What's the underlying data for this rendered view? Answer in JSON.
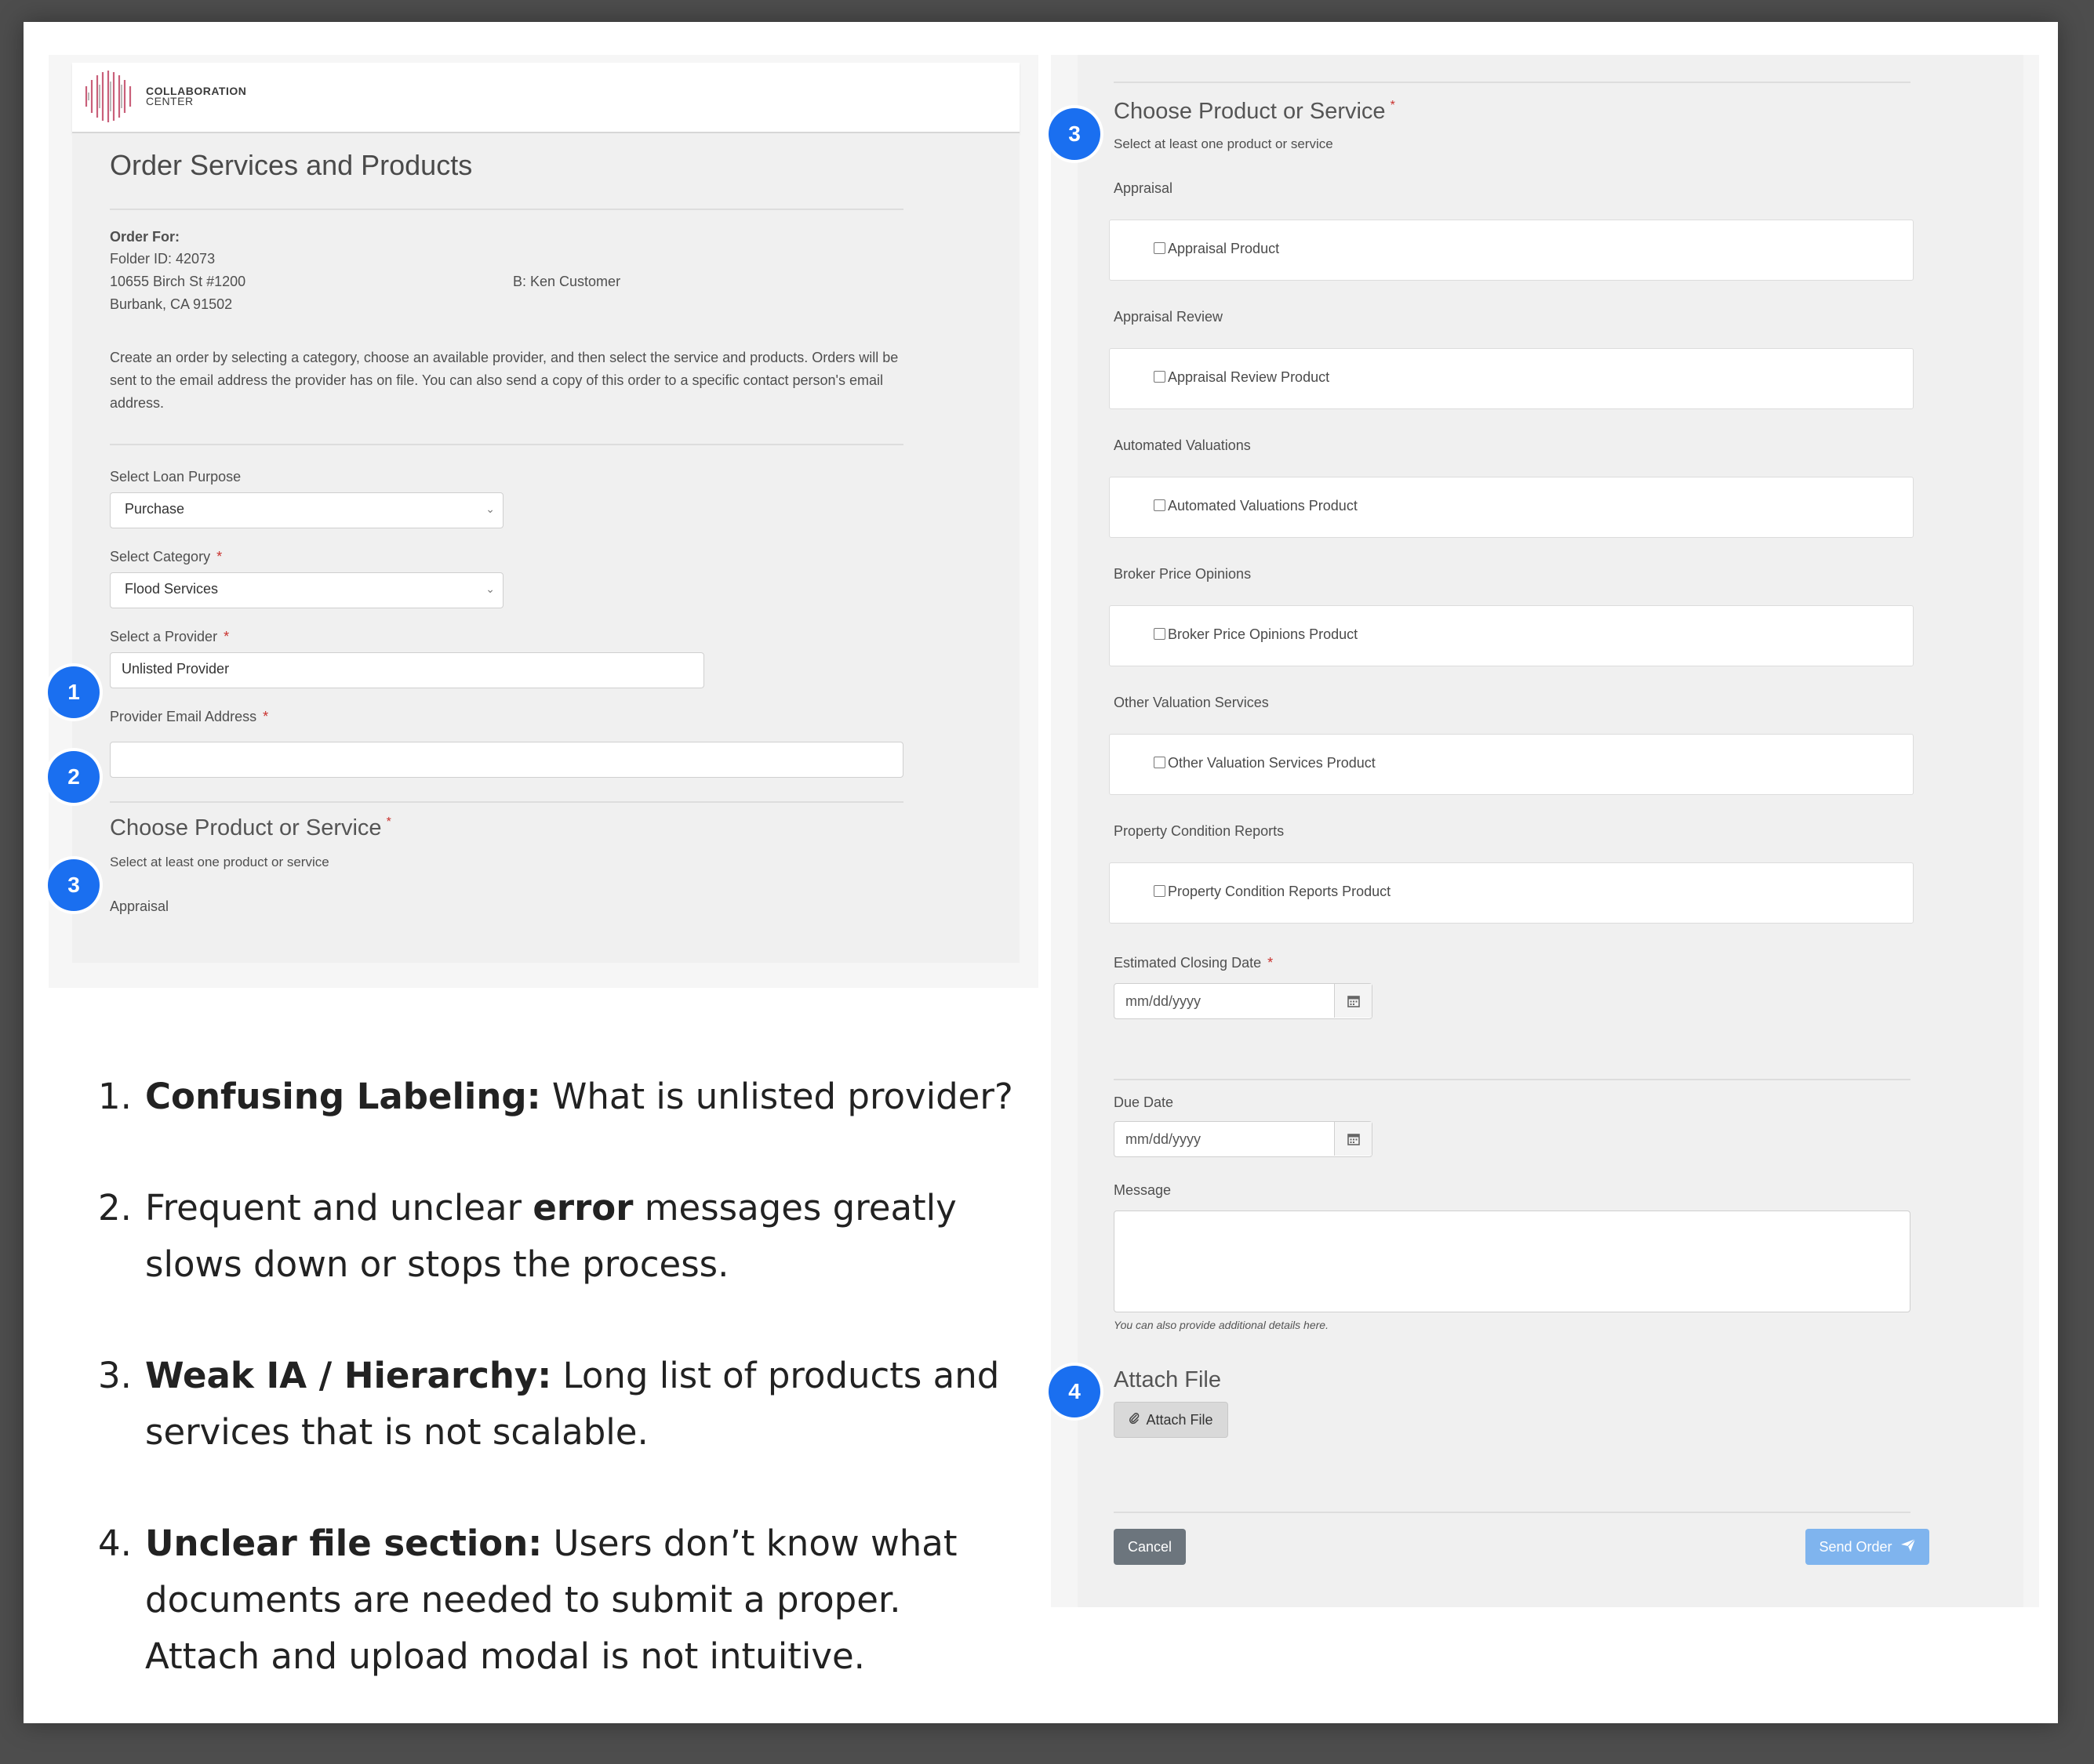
{
  "logo": {
    "line1": "COLLABORATION",
    "line2": "CENTER"
  },
  "left_form": {
    "title": "Order Services and Products",
    "order_for_label": "Order For:",
    "folder_id": "Folder ID: 42073",
    "address_line1": "10655 Birch St #1200",
    "address_line2": "Burbank, CA 91502",
    "borrower": "B: Ken Customer",
    "instructions": "Create an order by selecting a category, choose an available provider, and then select the service and products. Orders will be sent to the email address the provider has on file. You can also send a copy of this order to a specific contact person's email address.",
    "loan_purpose_label": "Select Loan Purpose",
    "loan_purpose_value": "Purchase",
    "category_label": "Select Category",
    "category_value": "Flood Services",
    "provider_label": "Select a Provider",
    "provider_value": "Unlisted Provider",
    "email_label": "Provider Email Address",
    "email_value": "",
    "choose_title": "Choose Product or Service",
    "choose_subtitle": "Select at least one product or service",
    "first_category": "Appraisal",
    "required_mark": "*"
  },
  "badges": {
    "b1": "1",
    "b2": "2",
    "b3": "3",
    "b4": "4"
  },
  "notes": [
    {
      "num": "1.",
      "bold": "Confusing Labeling:",
      "text_after": " What is unlisted provider?"
    },
    {
      "num": "2.",
      "text_before": "Frequent and unclear ",
      "bold": "error",
      "text_after": " messages greatly slows down or stops the process."
    },
    {
      "num": "3.",
      "bold": "Weak IA / Hierarchy:",
      "text_after": " Long list of products and services that is not scalable."
    },
    {
      "num": "4.",
      "bold": "Unclear file section:",
      "text_after": " Users don’t know what documents are needed to submit a proper. Attach and upload modal is not intuitive."
    }
  ],
  "right_form": {
    "choose_title": "Choose Product or Service",
    "choose_subtitle": "Select at least one product or service",
    "categories": [
      {
        "label": "Appraisal",
        "product": "Appraisal Product"
      },
      {
        "label": "Appraisal Review",
        "product": "Appraisal Review Product"
      },
      {
        "label": "Automated Valuations",
        "product": "Automated Valuations Product"
      },
      {
        "label": "Broker Price Opinions",
        "product": "Broker Price Opinions Product"
      },
      {
        "label": "Other Valuation Services",
        "product": "Other Valuation Services Product"
      },
      {
        "label": "Property Condition Reports",
        "product": "Property Condition Reports Product"
      }
    ],
    "closing_date_label": "Estimated Closing Date",
    "closing_date_placeholder": "mm/dd/yyyy",
    "due_date_label": "Due Date",
    "due_date_placeholder": "mm/dd/yyyy",
    "message_label": "Message",
    "message_help": "You can also provide additional details here.",
    "attach_title": "Attach File",
    "attach_button": "Attach File",
    "cancel_button": "Cancel",
    "send_button": "Send Order"
  }
}
